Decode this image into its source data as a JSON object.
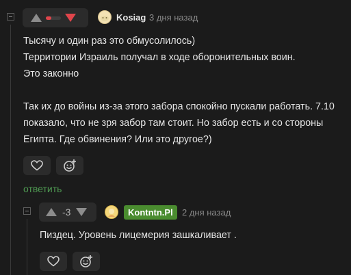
{
  "colors": {
    "background": "#1b1b1b",
    "text": "#e6e6e6",
    "muted": "#8a8a8a",
    "reply_link": "#4f9a52",
    "downvote_active": "#e0454b",
    "user_badge": "#4a8c2f"
  },
  "comments": [
    {
      "rating_fraction_negative": 0.35,
      "downvote_active": true,
      "username": "Kosiag",
      "time": "3 дня назад",
      "lines": [
        "Тысячу и один раз это обмусолилось)",
        "Территории Израиль получал в ходе оборонительных воин.",
        "Это законно",
        "",
        "Так их до войны из-за этого забора спокойно пускали работать. 7.10",
        "показало, что не зря забор там стоит. Но забор есть и со стороны",
        "Египта. Где обвинения? Или это другое?)"
      ],
      "reply_label": "ответить",
      "icons": {
        "like": "heart-icon",
        "react": "emoji-add-icon",
        "avatar": "avatar-icon"
      }
    },
    {
      "score": "-3",
      "username": "Kontntn.Pl",
      "username_highlighted": true,
      "time": "2 дня назад",
      "lines": [
        "Пиздец. Уровень лицемерия зашкаливает ."
      ],
      "icons": {
        "like": "heart-icon",
        "react": "emoji-add-icon",
        "avatar": "avatar-icon"
      }
    }
  ]
}
